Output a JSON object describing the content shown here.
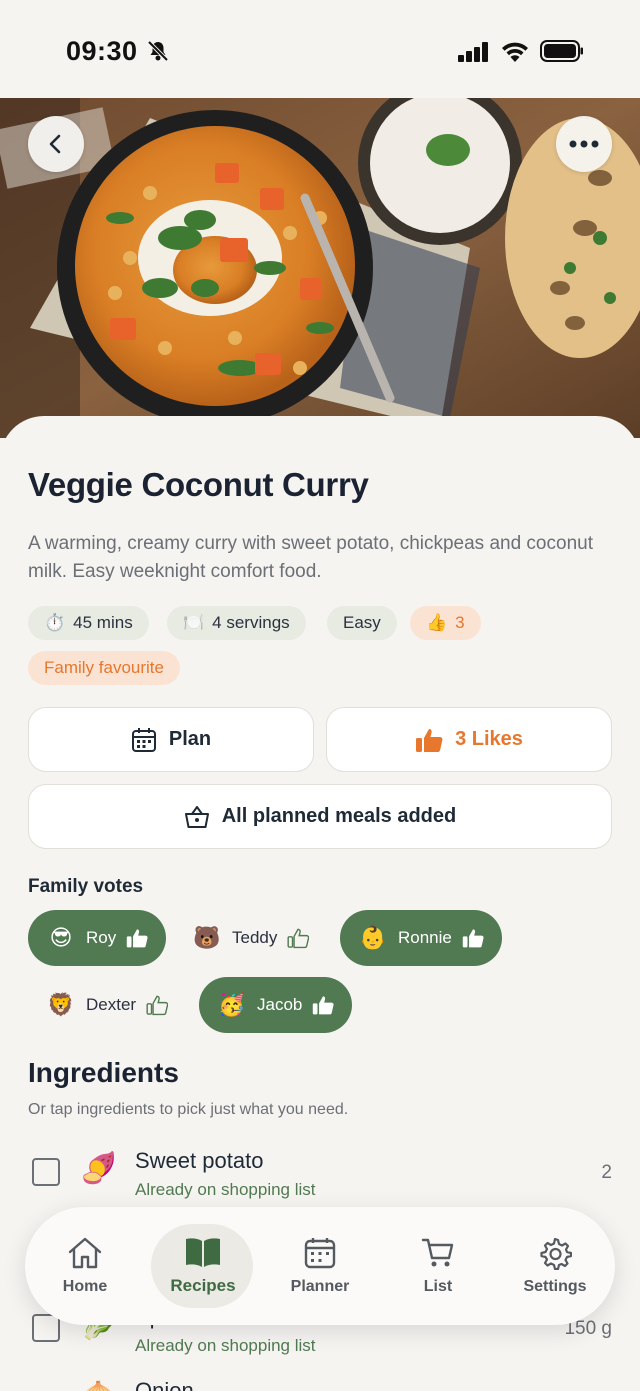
{
  "status": {
    "time": "09:30"
  },
  "recipe": {
    "title": "Veggie Coconut Curry",
    "description": "A warming, creamy curry with sweet potato, chickpeas and coconut milk. Easy weeknight comfort food.",
    "meta": {
      "time": "45 mins",
      "servings": "4 servings",
      "difficulty": "Easy",
      "likes_count": "3",
      "time_emoji": "⏱️",
      "servings_emoji": "🍽️",
      "likes_emoji": "👍"
    },
    "tag": "Family favourite"
  },
  "actions": {
    "plan": "Plan",
    "likes": "3 Likes",
    "add_meals": "All planned meals added"
  },
  "family_votes": {
    "label": "Family votes",
    "members": [
      {
        "name": "Roy",
        "emoji": "😎",
        "voted": true
      },
      {
        "name": "Teddy",
        "emoji": "🐻",
        "voted": false
      },
      {
        "name": "Ronnie",
        "emoji": "👶",
        "voted": true
      },
      {
        "name": "Dexter",
        "emoji": "🦁",
        "voted": false
      },
      {
        "name": "Jacob",
        "emoji": "🥳",
        "voted": true
      }
    ]
  },
  "ingredients": {
    "title": "Ingredients",
    "hint": "Or tap ingredients to pick just what you need.",
    "items": [
      {
        "name": "Sweet potato",
        "emoji": "🍠",
        "status": "Already on shopping list",
        "qty": "2"
      },
      {
        "name": "Spinach",
        "emoji": "🥬",
        "status": "Already on shopping list",
        "qty": "150 g"
      },
      {
        "name": "Onion",
        "emoji": "🧅",
        "status": "",
        "qty": ""
      }
    ]
  },
  "tabs": [
    {
      "label": "Home",
      "icon": "home-icon"
    },
    {
      "label": "Recipes",
      "icon": "book-icon"
    },
    {
      "label": "Planner",
      "icon": "calendar-icon"
    },
    {
      "label": "List",
      "icon": "cart-icon"
    },
    {
      "label": "Settings",
      "icon": "gear-icon"
    }
  ],
  "colors": {
    "accent_green": "#517a52",
    "accent_orange": "#e7772d",
    "background": "#f6f4f1"
  }
}
